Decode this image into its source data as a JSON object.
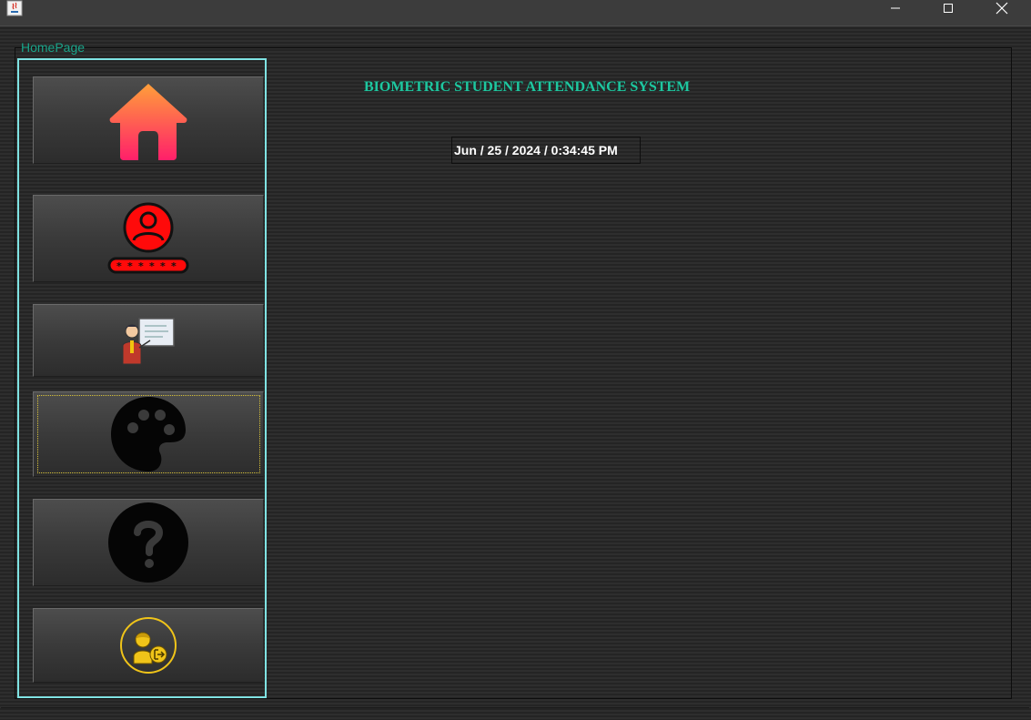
{
  "window": {
    "frame_label": "HomePage"
  },
  "header": {
    "title": "BIOMETRIC STUDENT ATTENDANCE SYSTEM",
    "datetime": "Jun / 25 / 2024 / 0:34:45 PM"
  },
  "sidebar": {
    "items": [
      {
        "icon": "home-icon"
      },
      {
        "icon": "user-login-icon"
      },
      {
        "icon": "teacher-presentation-icon"
      },
      {
        "icon": "palette-icon"
      },
      {
        "icon": "help-icon"
      },
      {
        "icon": "logout-user-icon"
      }
    ]
  },
  "colors": {
    "accent_teal": "#1fc7a0",
    "sidebar_border": "#7fe3e3",
    "focus_ring": "#d8c23a"
  }
}
